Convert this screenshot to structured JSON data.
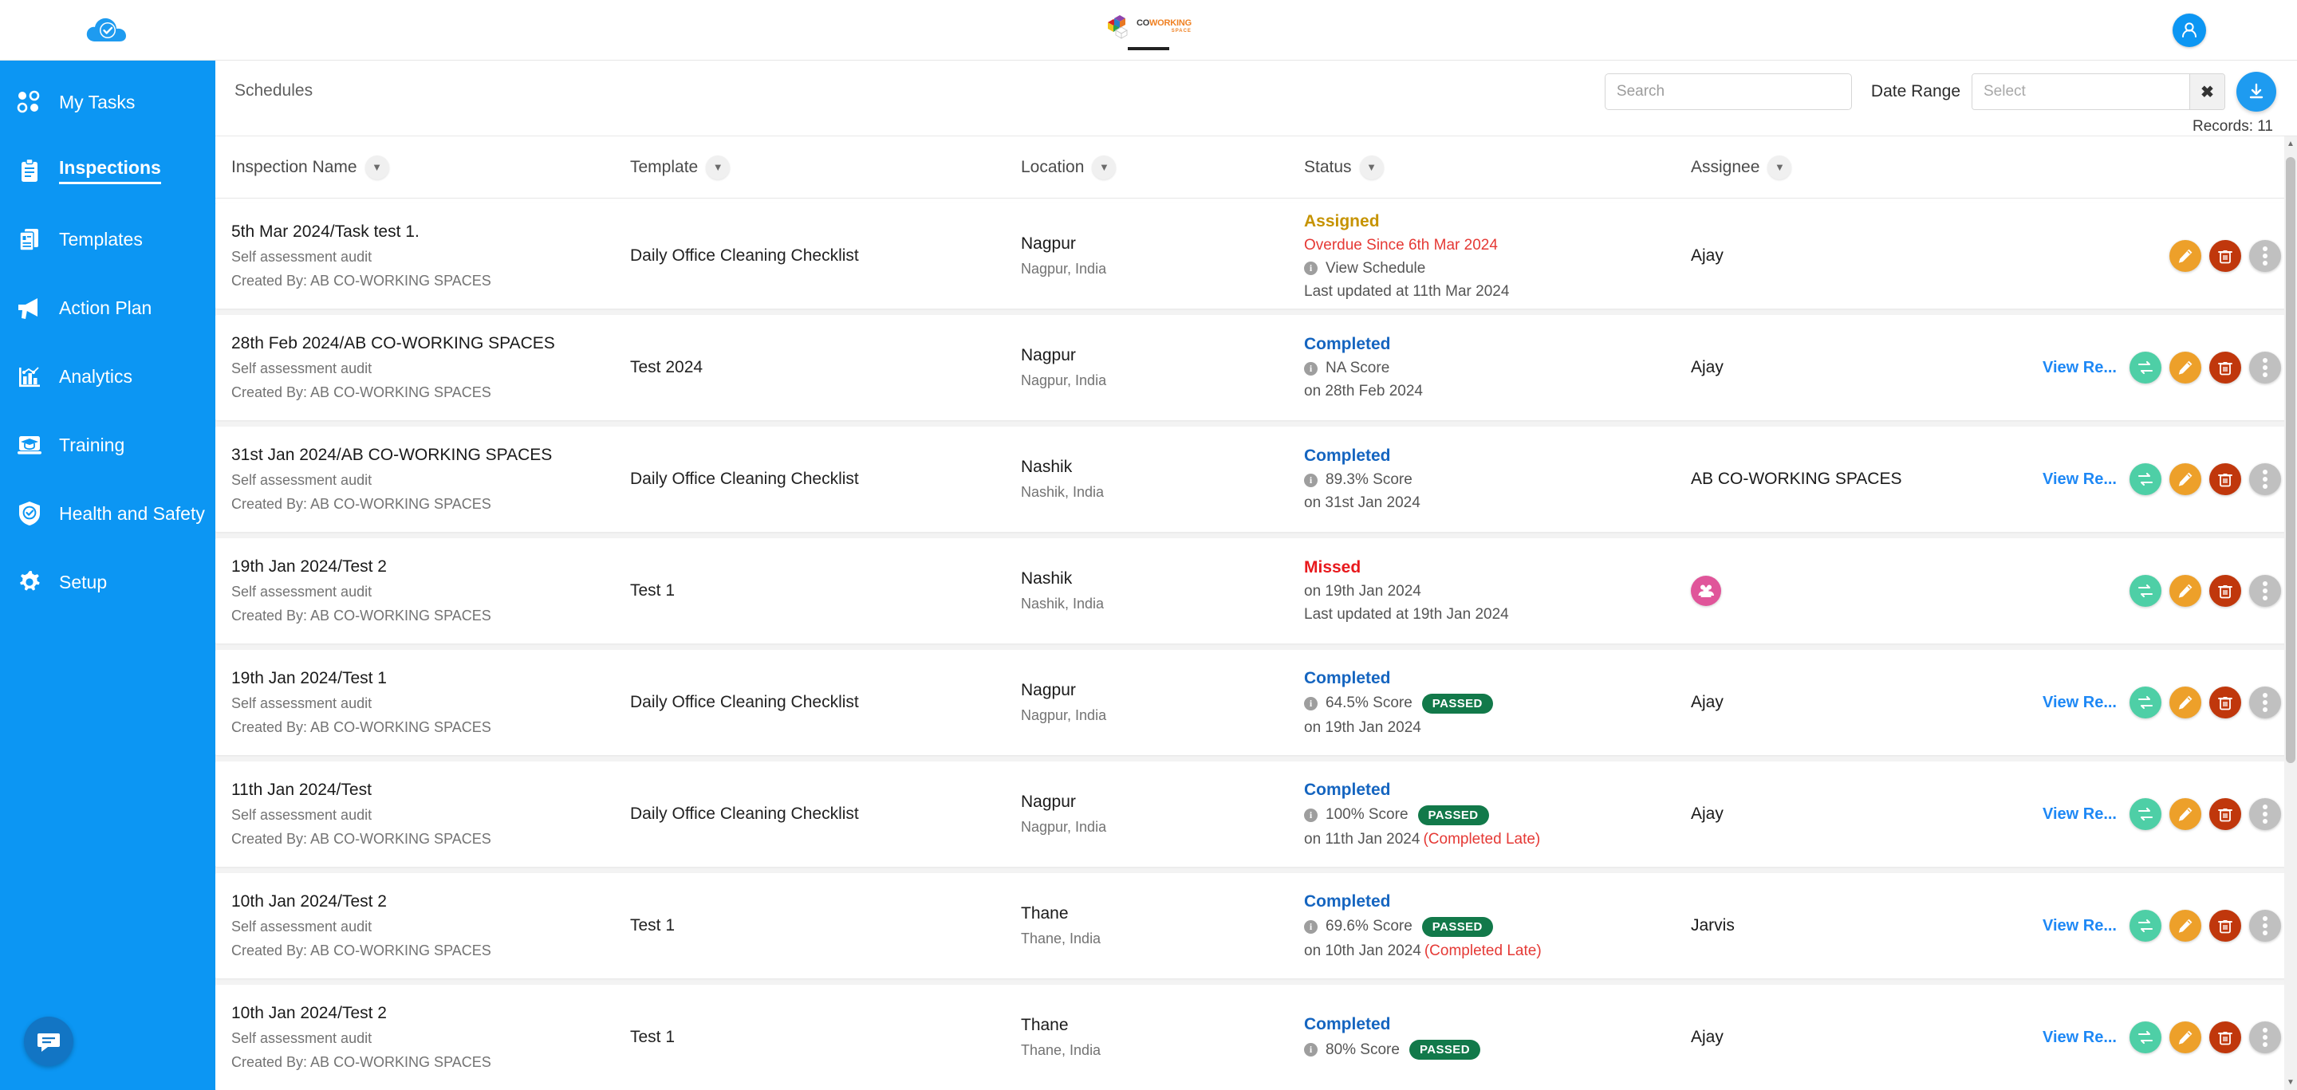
{
  "app": {
    "brand_logo_name": "cloud-check-logo",
    "center_brand": {
      "co": "CO",
      "working": "WORKING",
      "space": "SPACE"
    },
    "avatar_label": "user-avatar"
  },
  "sidebar": {
    "items": [
      {
        "label": "My Tasks",
        "icon": "tasks-icon",
        "active": false
      },
      {
        "label": "Inspections",
        "icon": "clipboard-icon",
        "active": true
      },
      {
        "label": "Templates",
        "icon": "documents-icon",
        "active": false
      },
      {
        "label": "Action Plan",
        "icon": "megaphone-icon",
        "active": false
      },
      {
        "label": "Analytics",
        "icon": "bar-chart-icon",
        "active": false
      },
      {
        "label": "Training",
        "icon": "graduation-icon",
        "active": false
      },
      {
        "label": "Health and Safety",
        "icon": "shield-check-icon",
        "active": false
      },
      {
        "label": "Setup",
        "icon": "gear-icon",
        "active": false
      }
    ],
    "chat_icon": "chat-bubble-icon"
  },
  "toolbar": {
    "breadcrumb": "Schedules",
    "search_placeholder": "Search",
    "search_value": "",
    "date_range_label": "Date Range",
    "date_range_placeholder": "Select",
    "date_range_value": "",
    "clear_glyph": "✖",
    "download_icon": "download-icon",
    "records_text": "Records: 11"
  },
  "table": {
    "columns": [
      {
        "label": "Inspection Name"
      },
      {
        "label": "Template"
      },
      {
        "label": "Location"
      },
      {
        "label": "Status"
      },
      {
        "label": "Assignee"
      }
    ],
    "view_report_label": "View Re...",
    "rows": [
      {
        "name": "5th Mar 2024/Task test 1.",
        "sub1": "Self assessment audit",
        "sub2": "Created By: AB CO-WORKING SPACES",
        "template": "Daily Office Cleaning Checklist",
        "location": "Nagpur",
        "location_sub": "Nagpur, India",
        "status": "Assigned",
        "status_type": "assigned",
        "overdue": "Overdue Since 6th Mar 2024",
        "info_line": "View Schedule",
        "date_line": "Last updated at 11th Mar 2024",
        "score": "",
        "passed": false,
        "late": "",
        "assignee": "Ajay",
        "assignee_is_avatar": false,
        "has_view_report": false,
        "has_reassign": false
      },
      {
        "name": "28th Feb 2024/AB CO-WORKING SPACES",
        "sub1": "Self assessment audit",
        "sub2": "Created By: AB CO-WORKING SPACES",
        "template": "Test 2024",
        "location": "Nagpur",
        "location_sub": "Nagpur, India",
        "status": "Completed",
        "status_type": "completed",
        "overdue": "",
        "info_line": "NA  Score",
        "date_line": "on 28th Feb 2024",
        "score": "NA",
        "passed": false,
        "late": "",
        "assignee": "Ajay",
        "assignee_is_avatar": false,
        "has_view_report": true,
        "has_reassign": true
      },
      {
        "name": "31st Jan 2024/AB CO-WORKING SPACES",
        "sub1": "Self assessment audit",
        "sub2": "Created By: AB CO-WORKING SPACES",
        "template": "Daily Office Cleaning Checklist",
        "location": "Nashik",
        "location_sub": "Nashik, India",
        "status": "Completed",
        "status_type": "completed",
        "overdue": "",
        "info_line": "89.3%  Score",
        "date_line": "on 31st Jan 2024",
        "score": "89.3%",
        "passed": false,
        "late": "",
        "assignee": "AB CO-WORKING SPACES",
        "assignee_is_avatar": false,
        "has_view_report": true,
        "has_reassign": true
      },
      {
        "name": "19th Jan 2024/Test 2",
        "sub1": "Self assessment audit",
        "sub2": "Created By: AB CO-WORKING SPACES",
        "template": "Test 1",
        "location": "Nashik",
        "location_sub": "Nashik, India",
        "status": "Missed",
        "status_type": "missed",
        "overdue": "",
        "info_line": "on 19th Jan 2024",
        "date_line": "Last updated at 19th Jan 2024",
        "score": "",
        "passed": false,
        "late": "",
        "assignee": "",
        "assignee_is_avatar": true,
        "has_view_report": false,
        "has_reassign": true
      },
      {
        "name": "19th Jan 2024/Test 1",
        "sub1": "Self assessment audit",
        "sub2": "Created By: AB CO-WORKING SPACES",
        "template": "Daily Office Cleaning Checklist",
        "location": "Nagpur",
        "location_sub": "Nagpur, India",
        "status": "Completed",
        "status_type": "completed",
        "overdue": "",
        "info_line": "64.5% Score",
        "date_line": "on 19th Jan 2024",
        "score": "64.5%",
        "passed": true,
        "passed_label": "PASSED",
        "late": "",
        "assignee": "Ajay",
        "assignee_is_avatar": false,
        "has_view_report": true,
        "has_reassign": true
      },
      {
        "name": "11th Jan 2024/Test",
        "sub1": "Self assessment audit",
        "sub2": "Created By: AB CO-WORKING SPACES",
        "template": "Daily Office Cleaning Checklist",
        "location": "Nagpur",
        "location_sub": "Nagpur, India",
        "status": "Completed",
        "status_type": "completed",
        "overdue": "",
        "info_line": "100% Score",
        "date_line": "on 11th Jan 2024",
        "score": "100%",
        "passed": true,
        "passed_label": "PASSED",
        "late": "(Completed Late)",
        "assignee": "Ajay",
        "assignee_is_avatar": false,
        "has_view_report": true,
        "has_reassign": true
      },
      {
        "name": "10th Jan 2024/Test 2",
        "sub1": "Self assessment audit",
        "sub2": "Created By: AB CO-WORKING SPACES",
        "template": "Test 1",
        "location": "Thane",
        "location_sub": "Thane, India",
        "status": "Completed",
        "status_type": "completed",
        "overdue": "",
        "info_line": "69.6% Score",
        "date_line": "on 10th Jan 2024",
        "score": "69.6%",
        "passed": true,
        "passed_label": "PASSED",
        "late": "(Completed Late)",
        "assignee": "Jarvis",
        "assignee_is_avatar": false,
        "has_view_report": true,
        "has_reassign": true
      },
      {
        "name": "10th Jan 2024/Test 2",
        "sub1": "Self assessment audit",
        "sub2": "Created By: AB CO-WORKING SPACES",
        "template": "Test 1",
        "location": "Thane",
        "location_sub": "Thane, India",
        "status": "Completed",
        "status_type": "completed",
        "overdue": "",
        "info_line": "80% Score",
        "date_line": "",
        "score": "80%",
        "passed": true,
        "passed_label": "PASSED",
        "late": "",
        "assignee": "Ajay",
        "assignee_is_avatar": false,
        "has_view_report": true,
        "has_reassign": true
      }
    ]
  },
  "colors": {
    "brand_blue": "#0c96f3",
    "status_assigned": "#c69300",
    "status_completed": "#1565c0",
    "status_missed": "#e8191d",
    "passed_green": "#12794a",
    "edit_orange": "#eda02a",
    "delete_red": "#c0370c",
    "reassign_teal": "#4ecfa6"
  }
}
